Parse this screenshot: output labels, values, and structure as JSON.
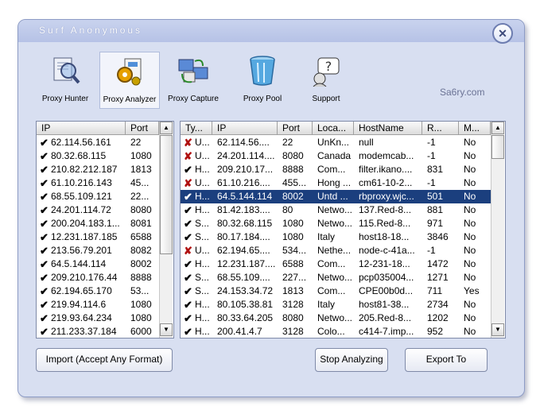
{
  "window": {
    "title": "Surf Anonymous",
    "close_glyph": "✕"
  },
  "toolbar": [
    {
      "label": "Proxy Hunter",
      "icon": "proxy-hunter-icon"
    },
    {
      "label": "Proxy Analyzer",
      "icon": "proxy-analyzer-icon",
      "active": true
    },
    {
      "label": "Proxy Capture",
      "icon": "proxy-capture-icon"
    },
    {
      "label": "Proxy Pool",
      "icon": "proxy-pool-icon"
    },
    {
      "label": "Support",
      "icon": "support-icon"
    }
  ],
  "brand": "Sa6ry.com",
  "left_list": {
    "columns": [
      "IP",
      "Port"
    ],
    "rows": [
      {
        "ip": "62.114.56.161",
        "port": "22"
      },
      {
        "ip": "80.32.68.115",
        "port": "1080"
      },
      {
        "ip": "210.82.212.187",
        "port": "1813"
      },
      {
        "ip": "61.10.216.143",
        "port": "45..."
      },
      {
        "ip": "68.55.109.121",
        "port": "22..."
      },
      {
        "ip": "24.201.114.72",
        "port": "8080"
      },
      {
        "ip": "200.204.183.1...",
        "port": "8081"
      },
      {
        "ip": "12.231.187.185",
        "port": "6588"
      },
      {
        "ip": "213.56.79.201",
        "port": "8082"
      },
      {
        "ip": "64.5.144.114",
        "port": "8002"
      },
      {
        "ip": "209.210.176.44",
        "port": "8888"
      },
      {
        "ip": "62.194.65.170",
        "port": "53..."
      },
      {
        "ip": "219.94.114.6",
        "port": "1080"
      },
      {
        "ip": "219.93.64.234",
        "port": "1080"
      },
      {
        "ip": "211.233.37.184",
        "port": "6000"
      }
    ]
  },
  "right_list": {
    "columns": [
      "Ty...",
      "IP",
      "Port",
      "Loca...",
      "HostName",
      "R...",
      "M..."
    ],
    "rows": [
      {
        "ok": false,
        "type": "U...",
        "ip": "62.114.56....",
        "port": "22",
        "loc": "UnKn...",
        "host": "null",
        "r": "-1",
        "m": "No"
      },
      {
        "ok": false,
        "type": "U...",
        "ip": "24.201.114....",
        "port": "8080",
        "loc": "Canada",
        "host": "modemcab...",
        "r": "-1",
        "m": "No"
      },
      {
        "ok": true,
        "type": "H...",
        "ip": "209.210.17...",
        "port": "8888",
        "loc": "Com...",
        "host": "filter.ikano....",
        "r": "831",
        "m": "No"
      },
      {
        "ok": false,
        "type": "U...",
        "ip": "61.10.216....",
        "port": "455...",
        "loc": "Hong ...",
        "host": "cm61-10-2...",
        "r": "-1",
        "m": "No"
      },
      {
        "ok": true,
        "type": "H...",
        "ip": "64.5.144.114",
        "port": "8002",
        "loc": "Untd ...",
        "host": "rbproxy.wjc...",
        "r": "501",
        "m": "No",
        "selected": true
      },
      {
        "ok": true,
        "type": "H...",
        "ip": "81.42.183....",
        "port": "80",
        "loc": "Netwo...",
        "host": "137.Red-8...",
        "r": "881",
        "m": "No"
      },
      {
        "ok": true,
        "type": "S...",
        "ip": "80.32.68.115",
        "port": "1080",
        "loc": "Netwo...",
        "host": "115.Red-8...",
        "r": "971",
        "m": "No"
      },
      {
        "ok": true,
        "type": "S...",
        "ip": "80.17.184....",
        "port": "1080",
        "loc": "Italy",
        "host": "host18-18...",
        "r": "3846",
        "m": "No"
      },
      {
        "ok": false,
        "type": "U...",
        "ip": "62.194.65....",
        "port": "534...",
        "loc": "Nethe...",
        "host": "node-c-41a...",
        "r": "-1",
        "m": "No"
      },
      {
        "ok": true,
        "type": "H...",
        "ip": "12.231.187....",
        "port": "6588",
        "loc": "Com...",
        "host": "12-231-18...",
        "r": "1472",
        "m": "No"
      },
      {
        "ok": true,
        "type": "S...",
        "ip": "68.55.109....",
        "port": "227...",
        "loc": "Netwo...",
        "host": "pcp035004...",
        "r": "1271",
        "m": "No"
      },
      {
        "ok": true,
        "type": "S...",
        "ip": "24.153.34.72",
        "port": "1813",
        "loc": "Com...",
        "host": "CPE00b0d...",
        "r": "711",
        "m": "Yes"
      },
      {
        "ok": true,
        "type": "H...",
        "ip": "80.105.38.81",
        "port": "3128",
        "loc": "Italy",
        "host": "host81-38...",
        "r": "2734",
        "m": "No"
      },
      {
        "ok": true,
        "type": "H...",
        "ip": "80.33.64.205",
        "port": "8080",
        "loc": "Netwo...",
        "host": "205.Red-8...",
        "r": "1202",
        "m": "No"
      },
      {
        "ok": true,
        "type": "H...",
        "ip": "200.41.4.7",
        "port": "3128",
        "loc": "Colo...",
        "host": "c414-7.imp...",
        "r": "952",
        "m": "No"
      }
    ]
  },
  "buttons": {
    "import": "Import (Accept Any Format)",
    "stop": "Stop Analyzing",
    "export": "Export To"
  },
  "glyphs": {
    "check": "✔",
    "cross": "✘",
    "up": "▲",
    "down": "▼"
  },
  "colors": {
    "selection": "#1b3f7e",
    "window_bg": "#d8dff1",
    "cross": "#b01010"
  }
}
